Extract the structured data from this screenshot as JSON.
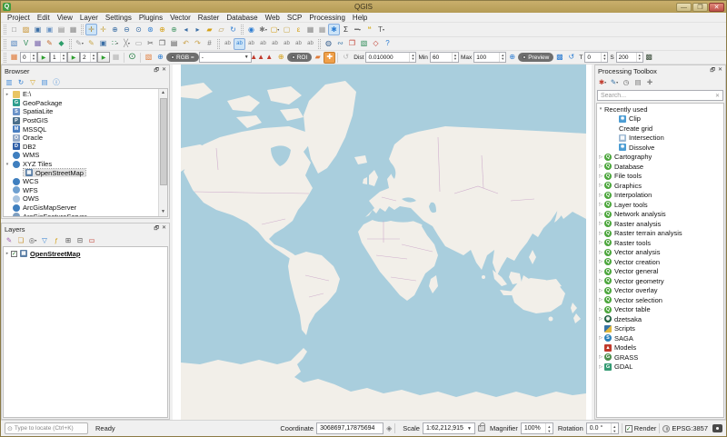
{
  "window": {
    "title": "QGIS",
    "minimize": "—",
    "maximize": "❐",
    "close": "✕"
  },
  "menu": {
    "items": [
      "Project",
      "Edit",
      "View",
      "Layer",
      "Settings",
      "Plugins",
      "Vector",
      "Raster",
      "Database",
      "Web",
      "SCP",
      "Processing",
      "Help"
    ]
  },
  "toolbar1": {
    "project": [
      {
        "n": "new-project-button",
        "g": "□",
        "c": "#777777"
      },
      {
        "n": "open-project-button",
        "g": "▨",
        "c": "#c8922e"
      },
      {
        "n": "save-project-button",
        "g": "▣",
        "c": "#3a6ea5"
      },
      {
        "n": "save-project-as-button",
        "g": "▣",
        "c": "#6a94c5"
      },
      {
        "n": "new-print-layout-button",
        "g": "▤",
        "c": "#8a8a8a"
      },
      {
        "n": "layout-manager-button",
        "g": "▦",
        "c": "#8a8a8a"
      }
    ],
    "nav": [
      {
        "n": "pan-map-button",
        "g": "✛",
        "c": "#b08d3e",
        "active": true
      },
      {
        "n": "pan-to-selection-button",
        "g": "✛",
        "c": "#c9a84c"
      },
      {
        "n": "zoom-in-button",
        "g": "⊕",
        "c": "#3a6ea5"
      },
      {
        "n": "zoom-out-button",
        "g": "⊖",
        "c": "#3a6ea5"
      },
      {
        "n": "zoom-native-button",
        "g": "⊙",
        "c": "#3a6ea5"
      },
      {
        "n": "zoom-full-button",
        "g": "⊛",
        "c": "#2d7dd2"
      },
      {
        "n": "zoom-to-selection-button",
        "g": "⊕",
        "c": "#d4a017"
      },
      {
        "n": "zoom-to-layer-button",
        "g": "⊕",
        "c": "#4a9a6a"
      },
      {
        "n": "zoom-last-button",
        "g": "◂",
        "c": "#3a6ea5"
      },
      {
        "n": "zoom-next-button",
        "g": "▸",
        "c": "#3a6ea5"
      },
      {
        "n": "new-bookmark-button",
        "g": "▰",
        "c": "#d4a017"
      },
      {
        "n": "show-bookmarks-button",
        "g": "▱",
        "c": "#b08d3e"
      },
      {
        "n": "refresh-map-button",
        "g": "↻",
        "c": "#2d7dd2"
      }
    ],
    "attr": [
      {
        "n": "identify-features-button",
        "g": "◉",
        "c": "#2d7dd2"
      },
      {
        "n": "run-feature-action-button",
        "g": "✱",
        "c": "#777777",
        "arrow": true
      },
      {
        "n": "select-features-button",
        "g": "▢",
        "c": "#d4a017",
        "arrow": true
      },
      {
        "n": "deselect-features-button",
        "g": "▢",
        "c": "#c9a84c"
      },
      {
        "n": "select-by-expression-button",
        "g": "ε",
        "c": "#d4a017"
      },
      {
        "n": "open-attribute-table-button",
        "g": "▦",
        "c": "#888888"
      },
      {
        "n": "field-calculator-button",
        "g": "▦",
        "c": "#9a9a9a"
      },
      {
        "n": "processing-toolbox-button",
        "g": "✱",
        "c": "#2d7dd2",
        "active": true
      },
      {
        "n": "statistical-summary-button",
        "g": "Σ",
        "c": "#333333"
      },
      {
        "n": "measure-line-button",
        "g": "━",
        "c": "#666666",
        "arrow": true
      },
      {
        "n": "map-tips-button",
        "g": "❝",
        "c": "#d8b63c"
      },
      {
        "n": "text-annotation-button",
        "g": "T",
        "c": "#555555",
        "arrow": true
      }
    ]
  },
  "toolbar2": {
    "layers": [
      {
        "n": "data-source-manager-button",
        "g": "▧",
        "c": "#4f81bd"
      },
      {
        "n": "add-vector-layer-button",
        "g": "V",
        "c": "#2e8b57"
      },
      {
        "n": "add-raster-layer-button",
        "g": "▦",
        "c": "#7b68ae"
      },
      {
        "n": "new-shapefile-layer-button",
        "g": "✎",
        "c": "#c46a2d"
      },
      {
        "n": "new-geopackage-layer-button",
        "g": "◆",
        "c": "#2e9e6b"
      }
    ],
    "digitize": [
      {
        "n": "current-edits-button",
        "g": "✎",
        "c": "#9a9a9a",
        "arrow": true
      },
      {
        "n": "toggle-editing-button",
        "g": "✎",
        "c": "#c9a84c"
      },
      {
        "n": "save-layer-edits-button",
        "g": "▣",
        "c": "#3a6ea5"
      },
      {
        "n": "add-feature-button",
        "g": "∷",
        "c": "#2e8b57",
        "arrow": true
      },
      {
        "n": "vertex-tool-button",
        "g": "╳",
        "c": "#888888",
        "arrow": true
      },
      {
        "n": "delete-selected-button",
        "g": "▭",
        "c": "#9a9a9a"
      },
      {
        "n": "cut-features-button",
        "g": "✂",
        "c": "#555555"
      },
      {
        "n": "copy-features-button",
        "g": "❐",
        "c": "#555555"
      },
      {
        "n": "paste-features-button",
        "g": "▤",
        "c": "#555555"
      },
      {
        "n": "undo-button",
        "g": "↶",
        "c": "#caa24a"
      },
      {
        "n": "redo-button",
        "g": "↷",
        "c": "#caa24a"
      },
      {
        "n": "modify-attributes-button",
        "g": "#",
        "c": "#777777"
      }
    ],
    "labels": [
      {
        "n": "layer-labeling-button",
        "g": "ab",
        "c": "#777777"
      },
      {
        "n": "highlight-labels-button",
        "g": "ab",
        "c": "#2d7dd2",
        "active": true
      },
      {
        "n": "pin-labels-button",
        "g": "ab",
        "c": "#777777"
      },
      {
        "n": "show-hide-labels-button",
        "g": "ab",
        "c": "#777777"
      },
      {
        "n": "move-label-button",
        "g": "ab",
        "c": "#777777"
      },
      {
        "n": "rotate-label-button",
        "g": "ab",
        "c": "#777777"
      },
      {
        "n": "label-properties-button",
        "g": "ab",
        "c": "#777777"
      },
      {
        "n": "diagram-options-button",
        "g": "ab",
        "c": "#777777"
      }
    ],
    "plugins": [
      {
        "n": "metasearch-button",
        "g": "◍",
        "c": "#355e8e"
      },
      {
        "n": "python-console-button",
        "g": "∾",
        "c": "#3573a6"
      },
      {
        "n": "scp-documentation-button",
        "g": "❐",
        "c": "#c0392b"
      },
      {
        "n": "scp-plugin-button",
        "g": "▧",
        "c": "#2e8b57"
      },
      {
        "n": "scp-roi-button",
        "g": "◇",
        "c": "#c0392b"
      },
      {
        "n": "help-contents-button",
        "g": "?",
        "c": "#2d7dd2"
      }
    ]
  },
  "scp": {
    "bands": [
      "0",
      "1",
      "2"
    ],
    "rgb_label": "RGB =",
    "rgb_value": "-",
    "roi_label": "ROI",
    "dist_label": "Dist",
    "dist_value": "0.010000",
    "min_label": "Min",
    "min_value": "60",
    "max_label": "Max",
    "max_value": "100",
    "preview_label": "Preview",
    "t_label": "T",
    "t_value": "0",
    "s_label": "S",
    "s_value": "200"
  },
  "browser": {
    "title": "Browser",
    "dock_glyph": "🗗",
    "close_glyph": "✕",
    "toolbar": [
      {
        "n": "add-selected-layers-button",
        "g": "▥",
        "c": "#4a90d9"
      },
      {
        "n": "refresh-browser-button",
        "g": "↻",
        "c": "#2d7dd2"
      },
      {
        "n": "filter-browser-button",
        "g": "▽",
        "c": "#d4a017"
      },
      {
        "n": "collapse-all-button",
        "g": "▤",
        "c": "#4a90d9"
      },
      {
        "n": "browser-properties-button",
        "g": "ⓘ",
        "c": "#2d7dd2"
      }
    ],
    "items": [
      {
        "label": "E:\\",
        "icon": "drive-folder-icon",
        "c": "#e9c563",
        "expander": "▸",
        "indent": "0"
      },
      {
        "label": "GeoPackage",
        "icon": "geopackage-icon",
        "c": "#2e9e8e",
        "ig": "G",
        "indent": "0"
      },
      {
        "label": "SpatiaLite",
        "icon": "spatialite-icon",
        "c": "#6b93c8",
        "ig": "S",
        "indent": "0"
      },
      {
        "label": "PostGIS",
        "icon": "postgis-icon",
        "c": "#4a6e8a",
        "ig": "P",
        "indent": "0"
      },
      {
        "label": "MSSQL",
        "icon": "mssql-icon",
        "c": "#4a7fc1",
        "ig": "M",
        "indent": "0"
      },
      {
        "label": "Oracle",
        "icon": "oracle-icon",
        "c": "#93a9c8",
        "ig": "O",
        "indent": "0"
      },
      {
        "label": "DB2",
        "icon": "db2-icon",
        "c": "#2f5fa8",
        "ig": "D",
        "indent": "0"
      },
      {
        "label": "WMS",
        "icon": "wms-icon",
        "c": "#3f7fbf",
        "round": true,
        "indent": "0"
      },
      {
        "label": "XYZ Tiles",
        "icon": "xyz-tiles-icon",
        "c": "#3f7fbf",
        "round": true,
        "expander": "▾",
        "indent": "0"
      },
      {
        "label": "OpenStreetMap",
        "icon": "openstreetmap-icon",
        "c": "#5b7fa6",
        "ig": "▦",
        "indent": "1",
        "selected": true
      },
      {
        "label": "WCS",
        "icon": "wcs-icon",
        "c": "#3f7fbf",
        "round": true,
        "indent": "0"
      },
      {
        "label": "WFS",
        "icon": "wfs-icon",
        "c": "#6fa0d0",
        "round": true,
        "indent": "0"
      },
      {
        "label": "OWS",
        "icon": "ows-icon",
        "c": "#a9c4e0",
        "round": true,
        "indent": "0"
      },
      {
        "label": "ArcGisMapServer",
        "icon": "arcgis-mapserver-icon",
        "c": "#3f7fbf",
        "round": true,
        "indent": "0"
      },
      {
        "label": "ArcGisFeatureServer",
        "icon": "arcgis-featureserver-icon",
        "c": "#7f9fc0",
        "round": true,
        "indent": "0"
      }
    ]
  },
  "layers": {
    "title": "Layers",
    "dock_glyph": "🗗",
    "close_glyph": "✕",
    "toolbar": [
      {
        "n": "open-layer-styling-button",
        "g": "✎",
        "c": "#a05fb0"
      },
      {
        "n": "add-group-button",
        "g": "❏",
        "c": "#c8922e"
      },
      {
        "n": "manage-map-themes-button",
        "g": "◎",
        "c": "#555555",
        "arrow": true
      },
      {
        "n": "filter-legend-button",
        "g": "▽",
        "c": "#2d7dd2"
      },
      {
        "n": "filter-by-expression-button",
        "g": "ƒ",
        "c": "#d4a017"
      },
      {
        "n": "expand-all-button",
        "g": "⊞",
        "c": "#555555"
      },
      {
        "n": "collapse-all-layers-button",
        "g": "⊟",
        "c": "#555555"
      },
      {
        "n": "remove-layer-button",
        "g": "▭",
        "c": "#c0392b"
      }
    ],
    "layer": {
      "label": "OpenStreetMap",
      "check": "✓",
      "expander": "▸"
    }
  },
  "processing": {
    "title": "Processing Toolbox",
    "dock_glyph": "🗗",
    "close_glyph": "✕",
    "toolbar": [
      {
        "n": "processing-models-button",
        "g": "✱",
        "c": "#c0392b",
        "arrow": true
      },
      {
        "n": "processing-scripts-button",
        "g": "✎",
        "c": "#3573a6",
        "arrow": true
      },
      {
        "n": "processing-history-button",
        "g": "◷",
        "c": "#555555"
      },
      {
        "n": "processing-results-button",
        "g": "▤",
        "c": "#777777"
      },
      {
        "n": "processing-options-button",
        "g": "✚",
        "c": "#888888"
      }
    ],
    "search_placeholder": "Search...",
    "tree": [
      {
        "label": "Recently used",
        "expander": "▾",
        "indent": "0"
      },
      {
        "label": "Clip",
        "icon": "clip-algorithm-icon",
        "c": "#4b9cd3",
        "ig": "✱",
        "indent": "2"
      },
      {
        "label": "Create grid",
        "indent": "2"
      },
      {
        "label": "Intersection",
        "icon": "intersection-algorithm-icon",
        "c": "#9db8d2",
        "ig": "▦",
        "indent": "2"
      },
      {
        "label": "Dissolve",
        "icon": "dissolve-algorithm-icon",
        "c": "#4b9cd3",
        "ig": "✱",
        "indent": "2"
      },
      {
        "label": "Cartography",
        "expander": "▷",
        "icon": "qgis-provider-icon",
        "c": "#4ca63c",
        "ig": "Q",
        "round": true,
        "indent": "0"
      },
      {
        "label": "Database",
        "expander": "▷",
        "icon": "qgis-provider-icon",
        "c": "#4ca63c",
        "ig": "Q",
        "round": true,
        "indent": "0"
      },
      {
        "label": "File tools",
        "expander": "▷",
        "icon": "qgis-provider-icon",
        "c": "#4ca63c",
        "ig": "Q",
        "round": true,
        "indent": "0"
      },
      {
        "label": "Graphics",
        "expander": "▷",
        "icon": "qgis-provider-icon",
        "c": "#4ca63c",
        "ig": "Q",
        "round": true,
        "indent": "0"
      },
      {
        "label": "Interpolation",
        "expander": "▷",
        "icon": "qgis-provider-icon",
        "c": "#4ca63c",
        "ig": "Q",
        "round": true,
        "indent": "0"
      },
      {
        "label": "Layer tools",
        "expander": "▷",
        "icon": "qgis-provider-icon",
        "c": "#4ca63c",
        "ig": "Q",
        "round": true,
        "indent": "0"
      },
      {
        "label": "Network analysis",
        "expander": "▷",
        "icon": "qgis-provider-icon",
        "c": "#4ca63c",
        "ig": "Q",
        "round": true,
        "indent": "0"
      },
      {
        "label": "Raster analysis",
        "expander": "▷",
        "icon": "qgis-provider-icon",
        "c": "#4ca63c",
        "ig": "Q",
        "round": true,
        "indent": "0"
      },
      {
        "label": "Raster terrain analysis",
        "expander": "▷",
        "icon": "qgis-provider-icon",
        "c": "#4ca63c",
        "ig": "Q",
        "round": true,
        "indent": "0"
      },
      {
        "label": "Raster tools",
        "expander": "▷",
        "icon": "qgis-provider-icon",
        "c": "#4ca63c",
        "ig": "Q",
        "round": true,
        "indent": "0"
      },
      {
        "label": "Vector analysis",
        "expander": "▷",
        "icon": "qgis-provider-icon",
        "c": "#4ca63c",
        "ig": "Q",
        "round": true,
        "indent": "0"
      },
      {
        "label": "Vector creation",
        "expander": "▷",
        "icon": "qgis-provider-icon",
        "c": "#4ca63c",
        "ig": "Q",
        "round": true,
        "indent": "0"
      },
      {
        "label": "Vector general",
        "expander": "▷",
        "icon": "qgis-provider-icon",
        "c": "#4ca63c",
        "ig": "Q",
        "round": true,
        "indent": "0"
      },
      {
        "label": "Vector geometry",
        "expander": "▷",
        "icon": "qgis-provider-icon",
        "c": "#4ca63c",
        "ig": "Q",
        "round": true,
        "indent": "0"
      },
      {
        "label": "Vector overlay",
        "expander": "▷",
        "icon": "qgis-provider-icon",
        "c": "#4ca63c",
        "ig": "Q",
        "round": true,
        "indent": "0"
      },
      {
        "label": "Vector selection",
        "expander": "▷",
        "icon": "qgis-provider-icon",
        "c": "#4ca63c",
        "ig": "Q",
        "round": true,
        "indent": "0"
      },
      {
        "label": "Vector table",
        "expander": "▷",
        "icon": "qgis-provider-icon",
        "c": "#4ca63c",
        "ig": "Q",
        "round": true,
        "indent": "0"
      },
      {
        "label": "dzetsaka",
        "expander": "▷",
        "icon": "dzetsaka-provider-icon",
        "c": "#1e5e3e",
        "ig": "◉",
        "round": true,
        "indent": "0"
      },
      {
        "label": "Scripts",
        "icon": "python-scripts-icon",
        "c": "#3573a6",
        "py": true,
        "indent": "0"
      },
      {
        "label": "SAGA",
        "expander": "▷",
        "icon": "saga-provider-icon",
        "c": "#2980b9",
        "ig": "S",
        "round": true,
        "indent": "0"
      },
      {
        "label": "Models",
        "icon": "models-provider-icon",
        "c": "#c0392b",
        "ig": "▲",
        "indent": "0"
      },
      {
        "label": "GRASS",
        "expander": "▷",
        "icon": "grass-provider-icon",
        "c": "#4d8f4d",
        "ig": "G",
        "round": true,
        "indent": "0"
      },
      {
        "label": "GDAL",
        "expander": "▷",
        "icon": "gdal-provider-icon",
        "c": "#359b73",
        "ig": "G",
        "indent": "0"
      }
    ]
  },
  "status": {
    "locate_placeholder": "Type to locate (Ctrl+K)",
    "ready": "Ready",
    "coordinate_label": "Coordinate",
    "coordinate_value": "3068697,17875694",
    "scale_label": "Scale",
    "scale_value": "1:62,212,915",
    "magnifier_label": "Magnifier",
    "magnifier_value": "100%",
    "rotation_label": "Rotation",
    "rotation_value": "0.0 °",
    "render_label": "Render",
    "render_checked": "✓",
    "crs": "EPSG:3857"
  },
  "map": {
    "layer_name": "OpenStreetMap",
    "colors": {
      "ocean": "#a9cedd",
      "land": "#f2efe9",
      "border": "#c49ac4",
      "canvas": "#ffffff"
    }
  }
}
